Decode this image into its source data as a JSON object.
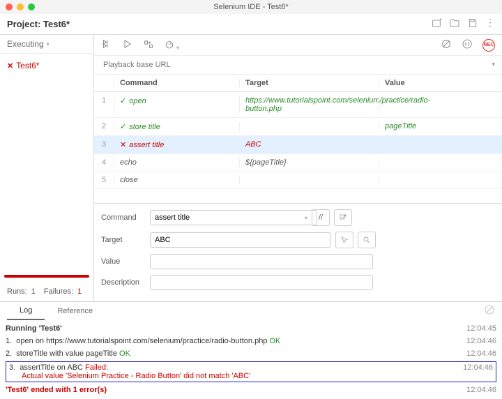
{
  "window": {
    "title": "Selenium IDE - Test6*"
  },
  "toolbar": {
    "project_label": "Project:",
    "project_name": "Test6*"
  },
  "sidebar": {
    "state_label": "Executing",
    "tests": [
      {
        "status": "fail",
        "name": "Test6*"
      }
    ],
    "runs_label": "Runs:",
    "runs": "1",
    "failures_label": "Failures:",
    "failures": "1"
  },
  "url_bar": {
    "placeholder": "Playback base URL"
  },
  "grid": {
    "headers": {
      "command": "Command",
      "target": "Target",
      "value": "Value"
    },
    "rows": [
      {
        "n": "1",
        "status": "pass",
        "command": "open",
        "target": "https://www.tutorialspoint.com/selenium/practice/radio-button.php",
        "value": ""
      },
      {
        "n": "2",
        "status": "pass",
        "command": "store title",
        "target": "",
        "value": "pageTitle"
      },
      {
        "n": "3",
        "status": "fail",
        "command": "assert title",
        "target": "ABC",
        "value": "",
        "selected": true
      },
      {
        "n": "4",
        "status": "none",
        "command": "echo",
        "target": "${pageTitle}",
        "value": ""
      },
      {
        "n": "5",
        "status": "none",
        "command": "close",
        "target": "",
        "value": ""
      }
    ]
  },
  "editor": {
    "labels": {
      "command": "Command",
      "target": "Target",
      "value": "Value",
      "description": "Description"
    },
    "command": "assert title",
    "target": "ABC",
    "value": "",
    "description": "",
    "slash_btn": "//"
  },
  "tabs": {
    "log": "Log",
    "reference": "Reference"
  },
  "log": [
    {
      "type": "bold",
      "msg": "Running 'Test6'",
      "time": "12:04:45"
    },
    {
      "type": "ok",
      "n": "1.",
      "msg": "open on https://www.tutorialspoint.com/selenium/practice/radio-button.php",
      "status": "OK",
      "time": "12:04:46"
    },
    {
      "type": "ok",
      "n": "2.",
      "msg": "storeTitle with value pageTitle",
      "status": "OK",
      "time": "12:04:46"
    },
    {
      "type": "err",
      "n": "3.",
      "msg": "assertTitle on ABC",
      "status": "Failed:",
      "detail": "Actual value 'Selenium Practice - Radio Button' did not match 'ABC'",
      "time": "12:04:46"
    },
    {
      "type": "err-bold",
      "msg": "'Test6' ended with 1 error(s)",
      "time": "12:04:46"
    }
  ]
}
